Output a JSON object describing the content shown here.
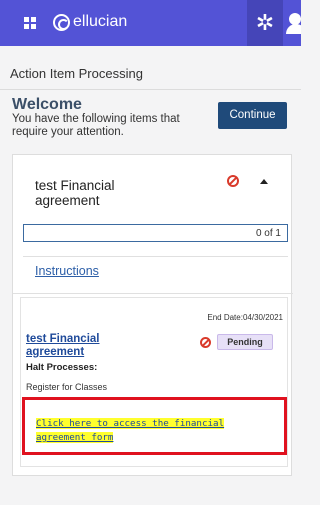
{
  "header": {
    "brand": "ellucian",
    "icons": {
      "menu": "grid-menu-icon",
      "brand": "ellucian-logo-icon",
      "settings": "gear-icon",
      "user": "user-icon"
    },
    "colors": {
      "bar": "#5353d6",
      "settings_bg": "#4545b8"
    }
  },
  "page": {
    "title": "Action Item Processing"
  },
  "welcome": {
    "heading": "Welcome",
    "message": "You have the following items that require your attention.",
    "continue_label": "Continue"
  },
  "item": {
    "title": "test Financial agreement",
    "status_icon": "blocked-icon",
    "expand_icon": "caret-up-icon",
    "progress": {
      "completed": 0,
      "total": 1,
      "label": "0 of 1"
    },
    "instructions_label": "Instructions"
  },
  "card": {
    "end_date": "End Date:04/30/2021",
    "title": "test Financial agreement",
    "status": "Pending",
    "halt_label": "Halt Processes:",
    "halt_value": "Register for Classes",
    "form_link": "Click here to access the financial agreement form",
    "colors": {
      "highlight": "#ffff2e",
      "callout_border": "#e0121f",
      "pending_bg": "#e7e0f7"
    }
  }
}
